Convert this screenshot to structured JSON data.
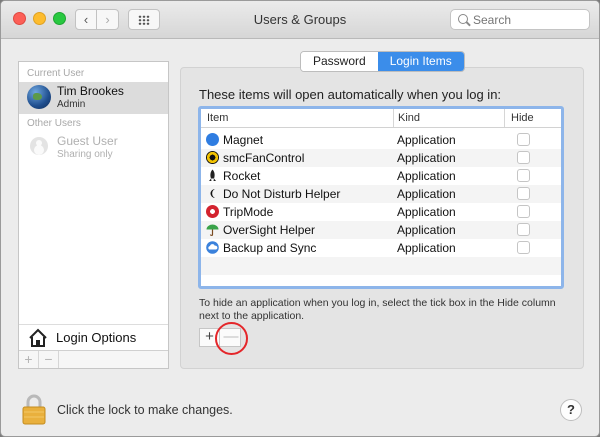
{
  "window": {
    "title": "Users & Groups"
  },
  "toolbar": {
    "back_glyph": "‹",
    "forward_glyph": "›"
  },
  "search": {
    "placeholder": "Search"
  },
  "sidebar": {
    "current_user_heading": "Current User",
    "current_user": {
      "name": "Tim Brookes",
      "role": "Admin"
    },
    "other_users_heading": "Other Users",
    "guest_user": {
      "name": "Guest User",
      "role": "Sharing only"
    },
    "login_options_label": "Login Options",
    "add_glyph": "+",
    "remove_glyph": "−"
  },
  "tabs": [
    {
      "label": "Password",
      "active": false
    },
    {
      "label": "Login Items",
      "active": true
    }
  ],
  "login_items": {
    "lead_text": "These items will open automatically when you log in:",
    "columns": {
      "item": "Item",
      "kind": "Kind",
      "hide": "Hide"
    },
    "rows": [
      {
        "name": "Magnet",
        "kind": "Application",
        "hide": false,
        "icon": "magnet-icon"
      },
      {
        "name": "smcFanControl",
        "kind": "Application",
        "hide": false,
        "icon": "fan-icon"
      },
      {
        "name": "Rocket",
        "kind": "Application",
        "hide": false,
        "icon": "rocket-icon"
      },
      {
        "name": "Do Not Disturb Helper",
        "kind": "Application",
        "hide": false,
        "icon": "dnd-icon"
      },
      {
        "name": "TripMode",
        "kind": "Application",
        "hide": false,
        "icon": "tripmode-icon"
      },
      {
        "name": "OverSight Helper",
        "kind": "Application",
        "hide": false,
        "icon": "umbrella-icon"
      },
      {
        "name": "Backup and Sync",
        "kind": "Application",
        "hide": false,
        "icon": "cloud-icon"
      }
    ],
    "help_text": "To hide an application when you log in, select the tick box in the Hide column next to the application.",
    "add_glyph": "+",
    "remove_glyph": "—"
  },
  "footer": {
    "lock_text": "Click the lock to make changes.",
    "help_glyph": "?"
  },
  "colors": {
    "accent": "#3b8dea",
    "highlight_circle": "#e4262a"
  }
}
